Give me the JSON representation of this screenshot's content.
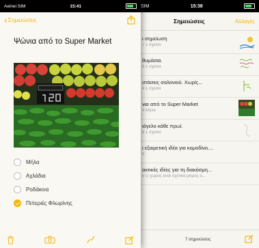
{
  "detail": {
    "status": {
      "carrier": "Aeinei SIM",
      "time": "15:41"
    },
    "back_label": "Σημειώσεις",
    "note_title": "Ψώνια από το Super Market",
    "checklist": [
      {
        "label": "Μήλα",
        "checked": false
      },
      {
        "label": "Αχλάδια",
        "checked": false
      },
      {
        "label": "Ροδάκινα",
        "checked": false
      },
      {
        "label": "Πιπεριές Φλωρίνης",
        "checked": true
      }
    ]
  },
  "list": {
    "status": {
      "carrier": "SIM",
      "time": "15:38"
    },
    "title": "Σημειώσεις",
    "edit_label": "Αλλαγές",
    "notes": [
      {
        "title": "ι σημείωση",
        "subtitle": "7 1 σχέδιο",
        "thumb": "drawing-thumbnail"
      },
      {
        "title": "θυμάσαι.",
        "subtitle": "6 1 σχέδιο",
        "thumb": "handwriting-thumbnail"
      },
      {
        "title": "στάσεις σαλονιού. Χωρίς...",
        "subtitle": "4 1 σχέδιο",
        "thumb": "sketch-thumbnail"
      },
      {
        "title": "νια από το Super Market",
        "subtitle": "4 Μήλα",
        "thumb": "vegetables-photo-thumbnail"
      },
      {
        "title": "ιόγελο κάθε πρωί.",
        "subtitle": "8 1 σχέδιο",
        "thumb": "sketch-thumbnail"
      },
      {
        "title": "ι εξαιρετική ιδέα για κομοδίνο....",
        "subtitle": "0",
        "thumb": ""
      },
      {
        "title": "ακτικές ιδέες για τη διακόσμη...",
        "subtitle": "5 Ο χώρος είναι σχετικά μικρός ό...",
        "thumb": ""
      }
    ],
    "count_label": "7 σημειώσεις"
  },
  "colors": {
    "accent": "#f4b400",
    "paper": "#faf8f2"
  }
}
